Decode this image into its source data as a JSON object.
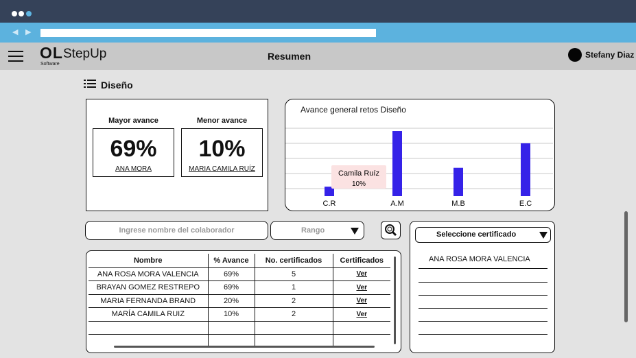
{
  "header": {
    "logo_mark": "OL",
    "logo_sub": "Software",
    "app_name": "StepUp",
    "page_title": "Resumen",
    "user_name": "Stefany Diaz"
  },
  "section": {
    "title": "Diseño"
  },
  "summary": {
    "best": {
      "title": "Mayor avance",
      "value": "69%",
      "name": "ANA MORA"
    },
    "worst": {
      "title": "Menor avance",
      "value": "10%",
      "name": "MARIA CAMILA RUÍZ"
    }
  },
  "chart_data": {
    "type": "bar",
    "title": "Avance general retos Diseño",
    "categories": [
      "C.R",
      "A.M",
      "M.B",
      "E.C"
    ],
    "values": [
      10,
      69,
      30,
      56
    ],
    "ylim": [
      0,
      85
    ],
    "grid": true,
    "bar_color": "#3522e8",
    "tooltip": {
      "category": "C.R",
      "name": "Camila Ruíz",
      "value": "10%"
    }
  },
  "filters": {
    "search_placeholder": "Ingrese nombre del colaborador",
    "range_label": "Rango"
  },
  "table": {
    "columns": [
      "Nombre",
      "% Avance",
      "No. certificados",
      "Certificados"
    ],
    "rows": [
      [
        "ANA ROSA MORA VALENCIA",
        "69%",
        "5",
        "Ver"
      ],
      [
        "BRAYAN GOMEZ RESTREPO",
        "69%",
        "1",
        "Ver"
      ],
      [
        "MARIA FERNANDA BRAND",
        "20%",
        "2",
        "Ver"
      ],
      [
        "MARÍA CAMILA RUIZ",
        "10%",
        "2",
        "Ver"
      ]
    ]
  },
  "certificates": {
    "select_label": "Seleccione certificado",
    "items": [
      "ANA ROSA MORA VALENCIA"
    ]
  }
}
